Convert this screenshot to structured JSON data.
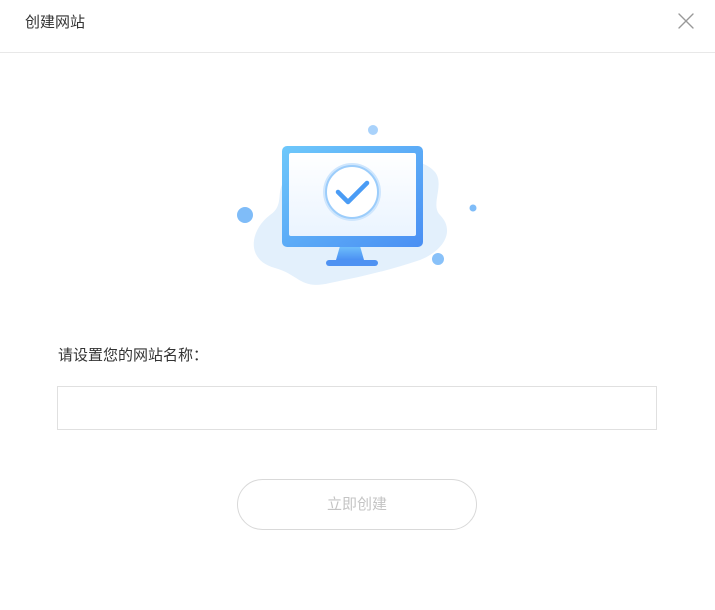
{
  "dialog": {
    "title": "创建网站",
    "close_icon": "close-icon"
  },
  "illustration": {
    "icon": "monitor-check-icon",
    "colors": {
      "accent": "#4a9cf5",
      "screen_light": "#6ec3fb",
      "blob": "#e3f0fc"
    }
  },
  "form": {
    "label": "请设置您的网站名称：",
    "input_value": "",
    "input_placeholder": ""
  },
  "actions": {
    "create_label": "立即创建",
    "create_disabled": true
  }
}
